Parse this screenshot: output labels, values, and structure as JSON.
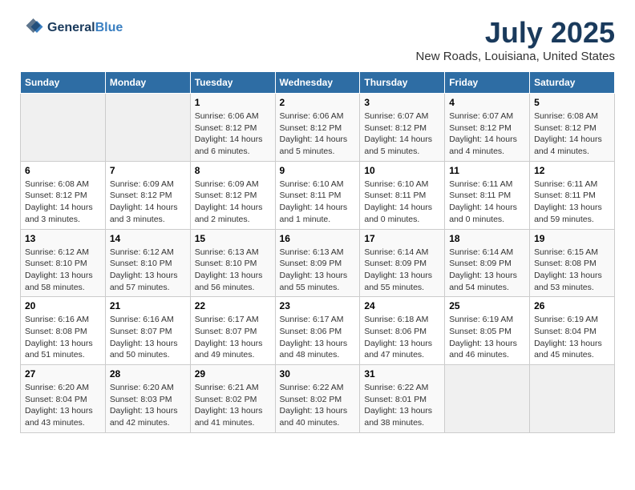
{
  "header": {
    "logo_line1": "General",
    "logo_line2": "Blue",
    "month": "July 2025",
    "location": "New Roads, Louisiana, United States"
  },
  "days_of_week": [
    "Sunday",
    "Monday",
    "Tuesday",
    "Wednesday",
    "Thursday",
    "Friday",
    "Saturday"
  ],
  "weeks": [
    [
      {
        "day": "",
        "empty": true
      },
      {
        "day": "",
        "empty": true
      },
      {
        "day": "1",
        "sunrise": "6:06 AM",
        "sunset": "8:12 PM",
        "daylight": "14 hours and 6 minutes."
      },
      {
        "day": "2",
        "sunrise": "6:06 AM",
        "sunset": "8:12 PM",
        "daylight": "14 hours and 5 minutes."
      },
      {
        "day": "3",
        "sunrise": "6:07 AM",
        "sunset": "8:12 PM",
        "daylight": "14 hours and 5 minutes."
      },
      {
        "day": "4",
        "sunrise": "6:07 AM",
        "sunset": "8:12 PM",
        "daylight": "14 hours and 4 minutes."
      },
      {
        "day": "5",
        "sunrise": "6:08 AM",
        "sunset": "8:12 PM",
        "daylight": "14 hours and 4 minutes."
      }
    ],
    [
      {
        "day": "6",
        "sunrise": "6:08 AM",
        "sunset": "8:12 PM",
        "daylight": "14 hours and 3 minutes."
      },
      {
        "day": "7",
        "sunrise": "6:09 AM",
        "sunset": "8:12 PM",
        "daylight": "14 hours and 3 minutes."
      },
      {
        "day": "8",
        "sunrise": "6:09 AM",
        "sunset": "8:12 PM",
        "daylight": "14 hours and 2 minutes."
      },
      {
        "day": "9",
        "sunrise": "6:10 AM",
        "sunset": "8:11 PM",
        "daylight": "14 hours and 1 minute."
      },
      {
        "day": "10",
        "sunrise": "6:10 AM",
        "sunset": "8:11 PM",
        "daylight": "14 hours and 0 minutes."
      },
      {
        "day": "11",
        "sunrise": "6:11 AM",
        "sunset": "8:11 PM",
        "daylight": "14 hours and 0 minutes."
      },
      {
        "day": "12",
        "sunrise": "6:11 AM",
        "sunset": "8:11 PM",
        "daylight": "13 hours and 59 minutes."
      }
    ],
    [
      {
        "day": "13",
        "sunrise": "6:12 AM",
        "sunset": "8:10 PM",
        "daylight": "13 hours and 58 minutes."
      },
      {
        "day": "14",
        "sunrise": "6:12 AM",
        "sunset": "8:10 PM",
        "daylight": "13 hours and 57 minutes."
      },
      {
        "day": "15",
        "sunrise": "6:13 AM",
        "sunset": "8:10 PM",
        "daylight": "13 hours and 56 minutes."
      },
      {
        "day": "16",
        "sunrise": "6:13 AM",
        "sunset": "8:09 PM",
        "daylight": "13 hours and 55 minutes."
      },
      {
        "day": "17",
        "sunrise": "6:14 AM",
        "sunset": "8:09 PM",
        "daylight": "13 hours and 55 minutes."
      },
      {
        "day": "18",
        "sunrise": "6:14 AM",
        "sunset": "8:09 PM",
        "daylight": "13 hours and 54 minutes."
      },
      {
        "day": "19",
        "sunrise": "6:15 AM",
        "sunset": "8:08 PM",
        "daylight": "13 hours and 53 minutes."
      }
    ],
    [
      {
        "day": "20",
        "sunrise": "6:16 AM",
        "sunset": "8:08 PM",
        "daylight": "13 hours and 51 minutes."
      },
      {
        "day": "21",
        "sunrise": "6:16 AM",
        "sunset": "8:07 PM",
        "daylight": "13 hours and 50 minutes."
      },
      {
        "day": "22",
        "sunrise": "6:17 AM",
        "sunset": "8:07 PM",
        "daylight": "13 hours and 49 minutes."
      },
      {
        "day": "23",
        "sunrise": "6:17 AM",
        "sunset": "8:06 PM",
        "daylight": "13 hours and 48 minutes."
      },
      {
        "day": "24",
        "sunrise": "6:18 AM",
        "sunset": "8:06 PM",
        "daylight": "13 hours and 47 minutes."
      },
      {
        "day": "25",
        "sunrise": "6:19 AM",
        "sunset": "8:05 PM",
        "daylight": "13 hours and 46 minutes."
      },
      {
        "day": "26",
        "sunrise": "6:19 AM",
        "sunset": "8:04 PM",
        "daylight": "13 hours and 45 minutes."
      }
    ],
    [
      {
        "day": "27",
        "sunrise": "6:20 AM",
        "sunset": "8:04 PM",
        "daylight": "13 hours and 43 minutes."
      },
      {
        "day": "28",
        "sunrise": "6:20 AM",
        "sunset": "8:03 PM",
        "daylight": "13 hours and 42 minutes."
      },
      {
        "day": "29",
        "sunrise": "6:21 AM",
        "sunset": "8:02 PM",
        "daylight": "13 hours and 41 minutes."
      },
      {
        "day": "30",
        "sunrise": "6:22 AM",
        "sunset": "8:02 PM",
        "daylight": "13 hours and 40 minutes."
      },
      {
        "day": "31",
        "sunrise": "6:22 AM",
        "sunset": "8:01 PM",
        "daylight": "13 hours and 38 minutes."
      },
      {
        "day": "",
        "empty": true
      },
      {
        "day": "",
        "empty": true
      }
    ]
  ]
}
